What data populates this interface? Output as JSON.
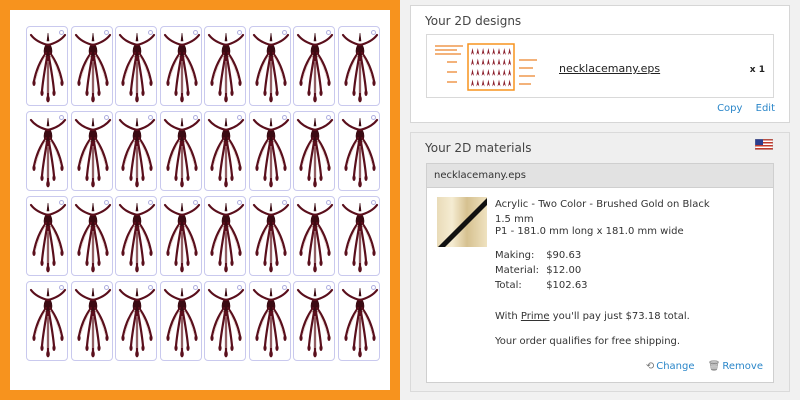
{
  "designs": {
    "title": "Your 2D designs",
    "items": [
      {
        "filename": "necklacemany.eps",
        "quantity": "x 1"
      }
    ],
    "copy_label": "Copy",
    "edit_label": "Edit"
  },
  "materials": {
    "title": "Your 2D materials",
    "flag_icon": "us-flag-icon",
    "item": {
      "filename": "necklacemany.eps",
      "material_name": "Acrylic - Two Color - Brushed Gold on Black",
      "thickness": "1.5 mm",
      "size": "P1 - 181.0 mm long x 181.0 mm wide",
      "making_label": "Making:",
      "making_value": "$90.63",
      "material_label": "Material:",
      "material_value": "$12.00",
      "total_label": "Total:",
      "total_value": "$102.63",
      "prime_prefix": "With ",
      "prime_link": "Prime",
      "prime_suffix": " you'll pay just $73.18 total.",
      "shipping_note": "Your order qualifies for free shipping.",
      "change_label": "Change",
      "remove_label": "Remove"
    }
  },
  "preview": {
    "columns": 8,
    "rows": 4,
    "frame_color": "#f7931e",
    "tile_border_color": "#c9c9ee"
  },
  "colors": {
    "link": "#2a86c9"
  }
}
